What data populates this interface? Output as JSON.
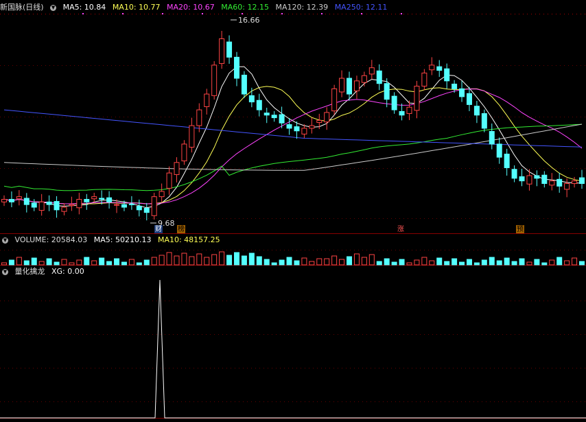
{
  "main": {
    "title": "新国脉(日线)",
    "ma": [
      {
        "label": "MA5: 10.84",
        "color": "#ffffff"
      },
      {
        "label": "MA10: 10.77",
        "color": "#ffff55"
      },
      {
        "label": "MA20: 10.67",
        "color": "#ff44ff"
      },
      {
        "label": "MA60: 12.15",
        "color": "#33ee33"
      },
      {
        "label": "MA120: 12.39",
        "color": "#cccccc"
      },
      {
        "label": "MA250: 12.11",
        "color": "#4455ff"
      }
    ],
    "high_label": "16.66",
    "low_label": "9.68",
    "tags": [
      "财",
      "榜",
      "涨",
      "预"
    ]
  },
  "volume": {
    "title": "VOLUME: 20584.03",
    "ma5": "MA5: 50210.13",
    "ma10": "MA10: 48157.25"
  },
  "indicator": {
    "title": "量化擒龙",
    "xg": "XG: 0.00"
  },
  "chart_data": {
    "type": "candlestick",
    "price_range_approx": [
      9.68,
      16.66
    ],
    "close_series_approx": [
      10.2,
      10.1,
      10.3,
      10.0,
      9.9,
      10.1,
      10.0,
      9.8,
      9.9,
      10.0,
      10.2,
      10.1,
      10.3,
      10.2,
      10.1,
      10.0,
      9.9,
      10.0,
      9.8,
      9.7,
      10.3,
      10.5,
      11.2,
      11.6,
      12.3,
      13.0,
      13.6,
      14.2,
      15.3,
      16.3,
      15.6,
      14.8,
      14.2,
      13.9,
      13.6,
      13.4,
      13.3,
      13.1,
      12.9,
      12.8,
      12.9,
      13.0,
      13.2,
      13.5,
      14.4,
      14.8,
      14.2,
      14.7,
      14.9,
      15.2,
      14.6,
      14.0,
      13.6,
      13.4,
      13.7,
      14.5,
      15.0,
      15.3,
      15.1,
      14.7,
      14.4,
      14.1,
      13.8,
      13.4,
      12.9,
      12.3,
      11.8,
      11.4,
      11.0,
      10.9,
      11.1,
      11.0,
      10.8,
      10.9,
      10.7,
      10.8,
      10.9,
      10.8
    ]
  }
}
